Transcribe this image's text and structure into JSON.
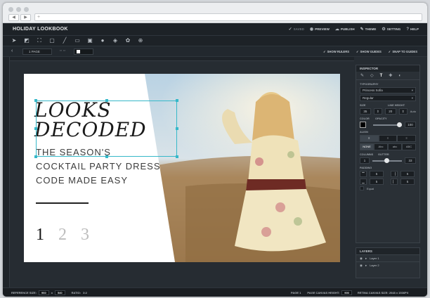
{
  "browser": {
    "url": "",
    "back": "◀",
    "forward": "▶",
    "reload": "+"
  },
  "app": {
    "title": "HOLIDAY LOOKBOOK",
    "actions": [
      {
        "label": "SAVED",
        "icon": "check-icon",
        "glyph": "✓",
        "dim": true
      },
      {
        "label": "PREVIEW",
        "icon": "eye-icon",
        "glyph": "◉"
      },
      {
        "label": "PUBLISH",
        "icon": "cloud-icon",
        "glyph": "☁"
      },
      {
        "label": "THEME",
        "icon": "brush-icon",
        "glyph": "✎"
      },
      {
        "label": "SETTING",
        "icon": "gear-icon",
        "glyph": "⚙"
      },
      {
        "label": "HELP",
        "icon": "question-icon",
        "glyph": "?"
      }
    ]
  },
  "tools": [
    {
      "name": "pointer-tool-icon",
      "glyph": "➤"
    },
    {
      "name": "image-edit-tool-icon",
      "glyph": "◩"
    },
    {
      "name": "crop-tool-icon",
      "glyph": "⛶"
    },
    {
      "name": "frame-tool-icon",
      "glyph": "▢"
    },
    {
      "name": "line-tool-icon",
      "glyph": "╱"
    },
    {
      "name": "image-tool-icon",
      "glyph": "▭"
    },
    {
      "name": "text-tool-icon",
      "glyph": "▣"
    },
    {
      "name": "color-tool-icon",
      "glyph": "●"
    },
    {
      "name": "layers-tool-icon",
      "glyph": "◈"
    },
    {
      "name": "shapes-tool-icon",
      "glyph": "✿"
    },
    {
      "name": "zoom-tool-icon",
      "glyph": "⊕"
    }
  ],
  "options": {
    "page_select": "1 PAGE",
    "toggles": [
      {
        "label": "SHOW RULERS",
        "glyph": "✓"
      },
      {
        "label": "SHOW GUIDES",
        "glyph": "✓"
      },
      {
        "label": "SNAP TO GUIDES",
        "glyph": "✓"
      }
    ]
  },
  "canvas": {
    "headline": [
      "LOOKS",
      "DECODED"
    ],
    "subtitle_lines": [
      "THE SEASON'S",
      "COCKTAIL PARTY DRESS",
      "CODE MADE EASY"
    ],
    "page_numbers": [
      "1",
      "2",
      "3"
    ],
    "colors": {
      "selection": "#36b8c9",
      "text": "#1a1a1a"
    }
  },
  "inspector": {
    "title": "INSPECTOR",
    "tabs": [
      "✎",
      "◇",
      "T",
      "✚",
      "◐"
    ],
    "section": "TYPOGRAPHY",
    "font_family": "Princess Sofia",
    "font_style": "Regular",
    "size_label": "SIZE",
    "line_height_label": "LINE HEIGHT",
    "size_value": "35",
    "line_height_value": "20",
    "auto_label": "Auto",
    "color_label": "COLOR",
    "opacity_label": "OPACITY",
    "opacity_value": "100",
    "align_label": "ALIGN",
    "align_options": [
      "≡",
      "≡",
      "≡"
    ],
    "case_options": [
      "NONE",
      "Abc",
      "abc",
      "ABC"
    ],
    "columns_label": "COLUMNS",
    "gutter_label": "GUTTER",
    "columns_value": "1",
    "gutter_value": "33",
    "padding_label": "PADDING",
    "padding_values": [
      "5",
      "5",
      "5",
      "5"
    ],
    "equal_label": "Equal"
  },
  "layers": {
    "title": "LAYERS",
    "items": [
      "Layer 1",
      "Layer 2"
    ]
  },
  "status": {
    "reference_size_label": "REFERENCE SIZE:",
    "reference_w": "960",
    "reference_x": "x",
    "reference_h": "540",
    "ratio_label": "RATIO:",
    "ratio_value": "3:2",
    "pages_label": "PAGE 1",
    "canvas_height_label": "PAGE CANVAS HEIGHT:",
    "canvas_height_value": "900",
    "retina_label": "RETINA CANVAS SIZE: 2048 x 1536PX"
  }
}
